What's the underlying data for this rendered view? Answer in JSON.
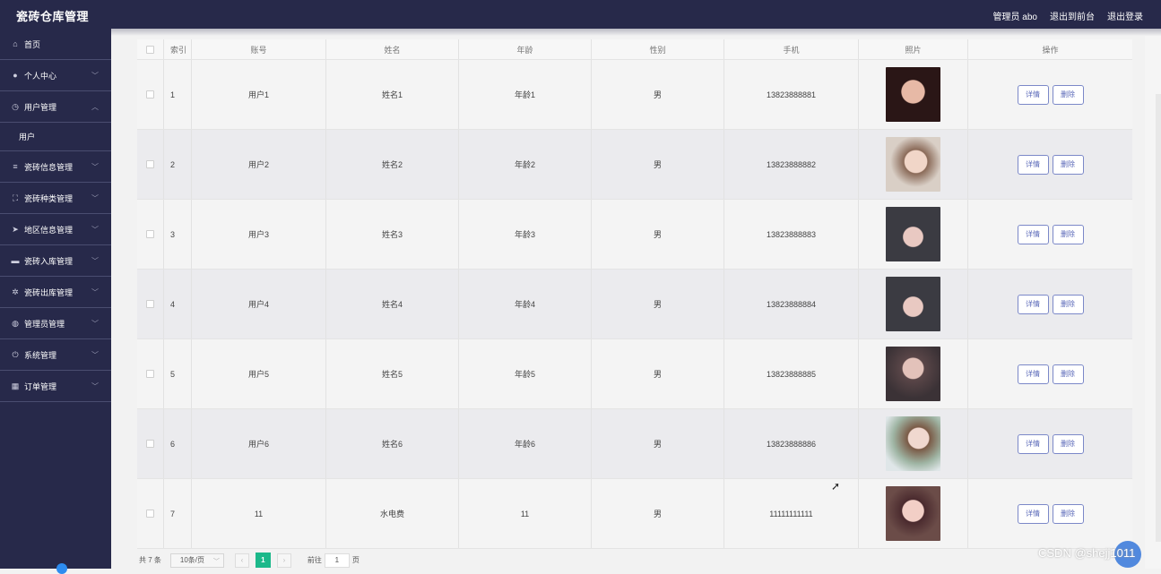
{
  "app": {
    "title": "瓷砖仓库管理"
  },
  "header": {
    "admin_label": "管理员 abo",
    "front_link": "退出到前台",
    "logout_link": "退出登录"
  },
  "sidebar": {
    "items": [
      {
        "label": "首页",
        "icon": "home-icon"
      },
      {
        "label": "个人中心",
        "icon": "person-icon"
      },
      {
        "label": "用户管理",
        "icon": "clock-icon"
      },
      {
        "label": "瓷砖信息管理",
        "icon": "list-icon"
      },
      {
        "label": "瓷砖种类管理",
        "icon": "frame-icon"
      },
      {
        "label": "地区信息管理",
        "icon": "send-icon"
      },
      {
        "label": "瓷砖入库管理",
        "icon": "monitor-icon"
      },
      {
        "label": "瓷砖出库管理",
        "icon": "gear-icon"
      },
      {
        "label": "管理员管理",
        "icon": "compass-icon"
      },
      {
        "label": "系统管理",
        "icon": "power-icon"
      },
      {
        "label": "订单管理",
        "icon": "chart-icon"
      }
    ],
    "sub_item": "用户"
  },
  "table": {
    "headers": [
      "",
      "索引",
      "账号",
      "姓名",
      "年龄",
      "性别",
      "手机",
      "照片",
      "操作"
    ],
    "rows": [
      {
        "index": "1",
        "account": "用户1",
        "name": "姓名1",
        "age": "年龄1",
        "gender": "男",
        "phone": "13823888881"
      },
      {
        "index": "2",
        "account": "用户2",
        "name": "姓名2",
        "age": "年龄2",
        "gender": "男",
        "phone": "13823888882"
      },
      {
        "index": "3",
        "account": "用户3",
        "name": "姓名3",
        "age": "年龄3",
        "gender": "男",
        "phone": "13823888883"
      },
      {
        "index": "4",
        "account": "用户4",
        "name": "姓名4",
        "age": "年龄4",
        "gender": "男",
        "phone": "13823888884"
      },
      {
        "index": "5",
        "account": "用户5",
        "name": "姓名5",
        "age": "年龄5",
        "gender": "男",
        "phone": "13823888885"
      },
      {
        "index": "6",
        "account": "用户6",
        "name": "姓名6",
        "age": "年龄6",
        "gender": "男",
        "phone": "13823888886"
      },
      {
        "index": "7",
        "account": "11",
        "name": "水电费",
        "age": "11",
        "gender": "男",
        "phone": "11111111111"
      }
    ],
    "detail_label": "详情",
    "delete_label": "删除"
  },
  "pager": {
    "total": "共 7 条",
    "page_size": "10条/页",
    "current_page": "1",
    "goto_label": "前往",
    "goto_value": "1",
    "page_suffix": "页",
    "prev": "‹",
    "next": "›"
  },
  "watermark": "CSDN @shejj1011",
  "colors": {
    "topbar": "#27294a",
    "accent": "#1cb88a",
    "button_border": "#7b88c8"
  }
}
